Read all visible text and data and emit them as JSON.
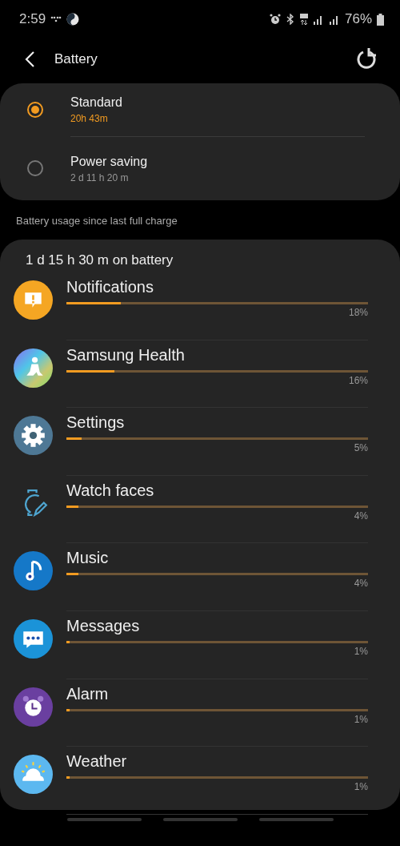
{
  "status_bar": {
    "time": "2:59",
    "battery_percent": "76%"
  },
  "header": {
    "title": "Battery"
  },
  "power_modes": [
    {
      "label": "Standard",
      "time": "20h 43m",
      "selected": true
    },
    {
      "label": "Power saving",
      "time": "2 d 11 h 20 m",
      "selected": false
    }
  ],
  "usage_caption": "Battery usage since last full charge",
  "usage": {
    "summary": "1 d 15 h 30 m on battery",
    "apps": [
      {
        "name": "Notifications",
        "kind": "notifications",
        "level": 0.18,
        "percent": "18%"
      },
      {
        "name": "Samsung Health",
        "kind": "health",
        "level": 0.16,
        "percent": "16%"
      },
      {
        "name": "Settings",
        "kind": "settings",
        "level": 0.05,
        "percent": "5%"
      },
      {
        "name": "Watch faces",
        "kind": "watchfaces",
        "level": 0.04,
        "percent": "4%"
      },
      {
        "name": "Music",
        "kind": "music",
        "level": 0.04,
        "percent": "4%"
      },
      {
        "name": "Messages",
        "kind": "messages",
        "level": 0.01,
        "percent": "1%"
      },
      {
        "name": "Alarm",
        "kind": "alarm",
        "level": 0.01,
        "percent": "1%"
      },
      {
        "name": "Weather",
        "kind": "weather",
        "level": 0.01,
        "percent": "1%"
      }
    ]
  }
}
